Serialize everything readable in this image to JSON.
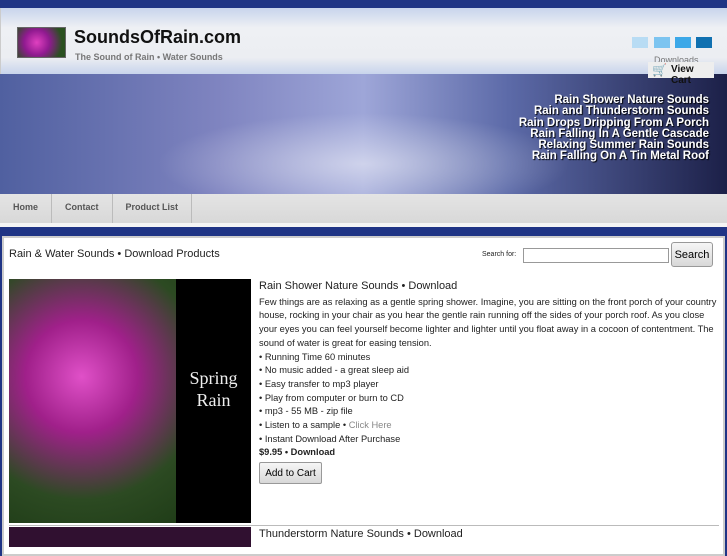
{
  "header": {
    "site_name": "SoundsOfRain.com",
    "tagline": "The Sound of Rain • Water Sounds",
    "downloads_label": "Downloads",
    "view_cart": "View Cart",
    "swatch_colors": [
      "#b8dcf4",
      "#7cc4f0",
      "#3ca8e8",
      "#1070b0"
    ]
  },
  "banner": {
    "titles": [
      "Rain Shower Nature Sounds",
      "Rain and Thunderstorm Sounds",
      "Rain Drops Dripping From A Porch",
      "Rain Falling In A Gentle Cascade",
      "Relaxing Summer Rain Sounds",
      "Rain Falling On A Tin Metal Roof"
    ]
  },
  "nav": [
    "Home",
    "Contact",
    "Product List"
  ],
  "main": {
    "heading": "Rain & Water Sounds • Download Products",
    "search_label": "Search for:",
    "search_value": "",
    "search_button": "Search",
    "products": [
      {
        "image_text_1": "Spring",
        "image_text_2": "Rain",
        "title": "Rain Shower Nature Sounds • Download",
        "description": "Few things are as relaxing as a gentle spring shower. Imagine, you are sitting on the front porch of your country house, rocking in your chair as you hear the gentle rain running off the sides of your porch roof. As you close your eyes you can feel yourself become lighter and lighter until you float away in a cocoon of contentment. The sound of water is great for easing tension.",
        "bullets": [
          "• Running Time 60 minutes",
          "• No music added - a great sleep aid",
          "• Easy transfer to mp3 player",
          "• Play from computer or burn to CD",
          "• mp3 - 55 MB - zip file"
        ],
        "sample_text": "• Listen to a sample • ",
        "sample_link": "Click Here",
        "instant": "• Instant Download After Purchase",
        "price": "$9.95 • Download",
        "add_to_cart": "Add to Cart"
      },
      {
        "title": "Thunderstorm Nature Sounds • Download"
      }
    ]
  }
}
